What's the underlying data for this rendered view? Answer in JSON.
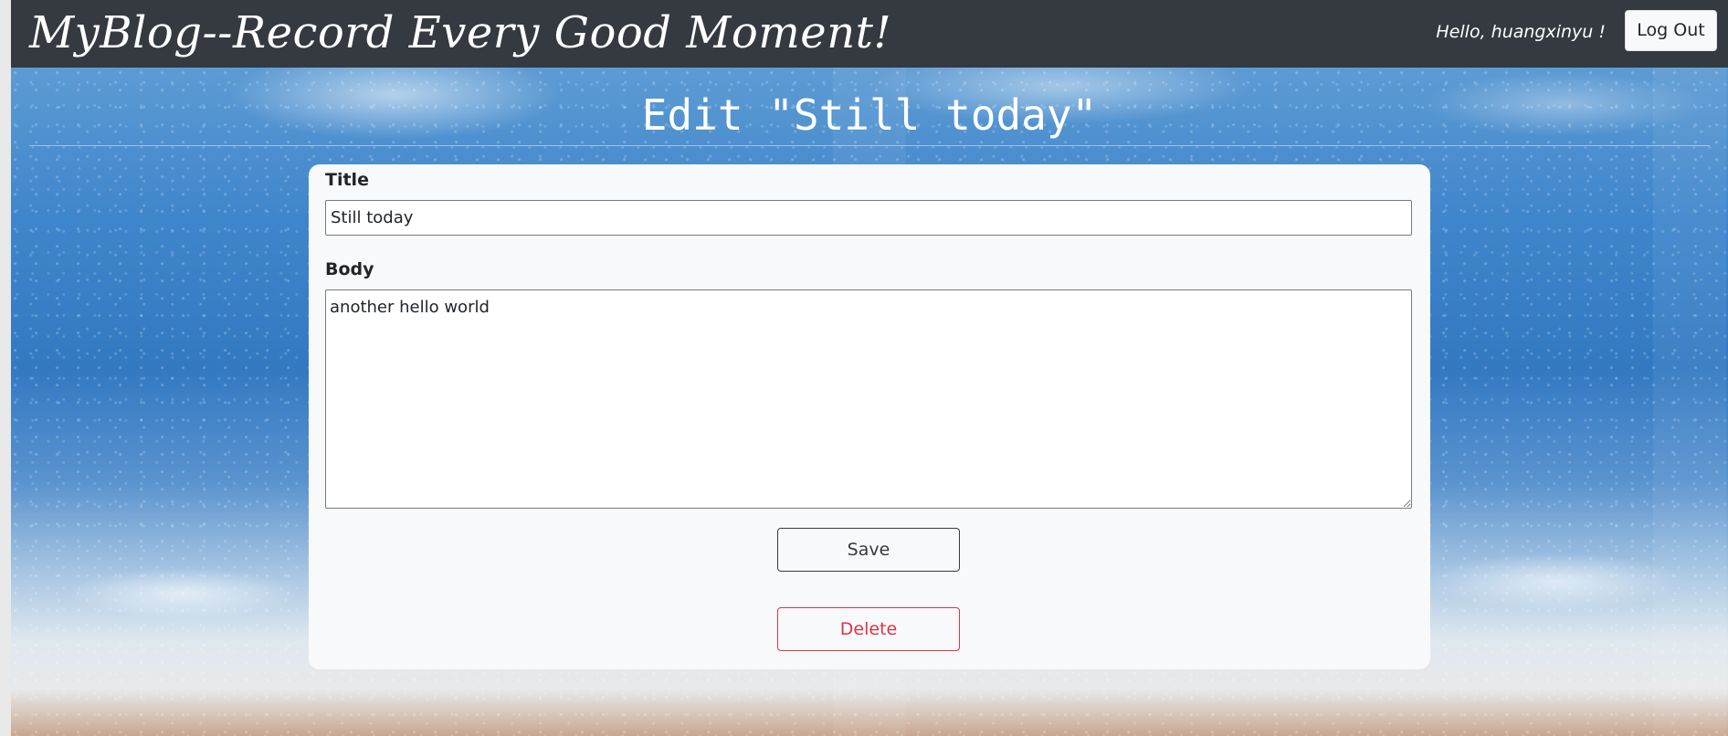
{
  "navbar": {
    "brand": "MyBlog--Record Every Good Moment!",
    "greeting": "Hello, huangxinyu !",
    "logout_label": "Log Out"
  },
  "page": {
    "heading": "Edit \"Still today\""
  },
  "form": {
    "title_label": "Title",
    "title_value": "Still today",
    "body_label": "Body",
    "body_value": "another hello world",
    "save_label": "Save",
    "delete_label": "Delete"
  },
  "colors": {
    "navbar_bg": "#343a40",
    "card_bg": "#f8f9fa",
    "save_border": "#343a40",
    "delete_accent": "#dc3545"
  }
}
